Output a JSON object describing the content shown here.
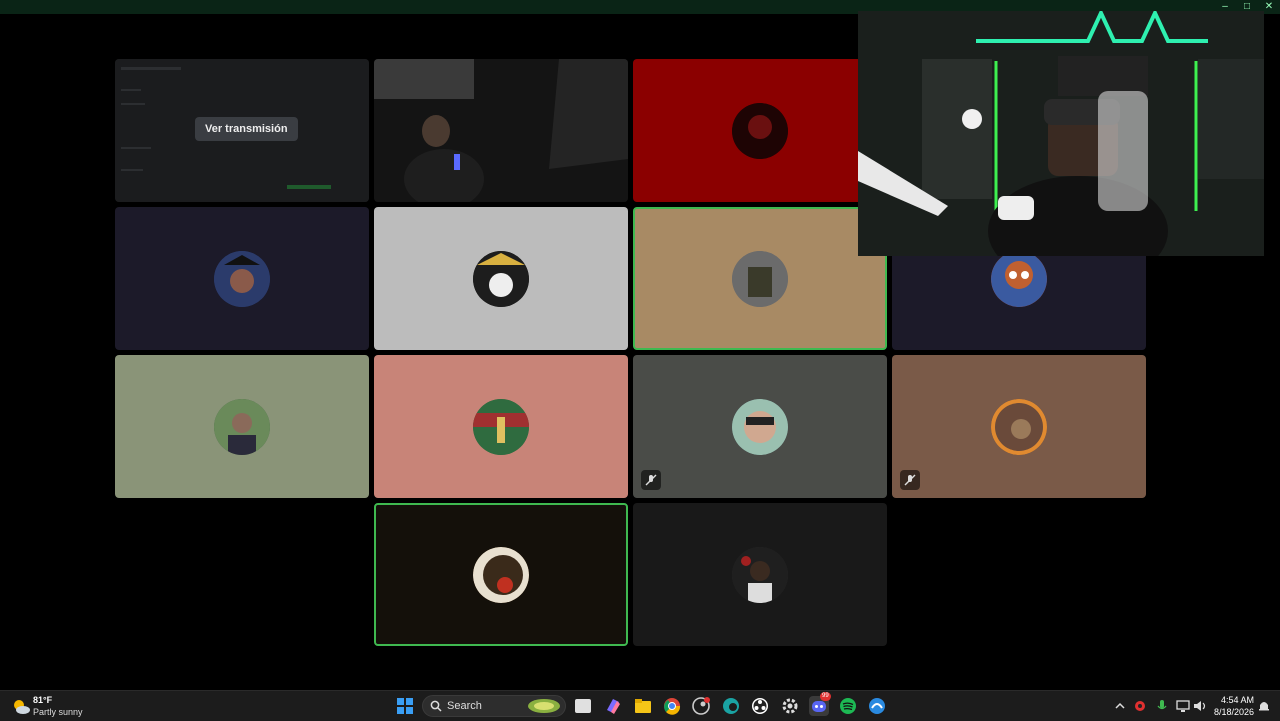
{
  "stream_tile": {
    "button_label": "Ver transmisión"
  },
  "tiles": [
    {
      "id": "stream",
      "bg": "#1a1a1a"
    },
    {
      "id": "video",
      "bg": "#151515"
    },
    {
      "id": "t3",
      "bg": "#8b0000",
      "avatar": "#2a0505"
    },
    {
      "id": "t4",
      "bg": "#1c1a29",
      "avatar": "#2b3b6b"
    },
    {
      "id": "t5",
      "bg": "#bcbcbc",
      "avatar": "#1d1d1d"
    },
    {
      "id": "t6",
      "bg": "#a88a64",
      "avatar": "#6b6b6b",
      "speaking": true
    },
    {
      "id": "t7",
      "bg": "#1c1a29",
      "avatar": "#b04a2a"
    },
    {
      "id": "t8",
      "bg": "#8a9478",
      "avatar": "#4a6a4a"
    },
    {
      "id": "t9",
      "bg": "#c88478",
      "avatar": "#2f6b3f"
    },
    {
      "id": "t10",
      "bg": "#4a4c48",
      "avatar": "#6a8a8a",
      "muted": true
    },
    {
      "id": "t11",
      "bg": "#7a5a48",
      "avatar": "#8a5a3a",
      "muted": true
    },
    {
      "id": "t12",
      "bg": "#14100a",
      "avatar": "#5a3a1a",
      "speaking": true
    },
    {
      "id": "t13",
      "bg": "#191919",
      "avatar": "#2a2a2a"
    }
  ],
  "taskbar": {
    "weather_temp": "81°F",
    "weather_condition": "Partly sunny",
    "search_label": "Search",
    "time": "4:54 AM",
    "date": "8/18/2026",
    "notification_badge": "99",
    "accent": "#3fb950"
  }
}
